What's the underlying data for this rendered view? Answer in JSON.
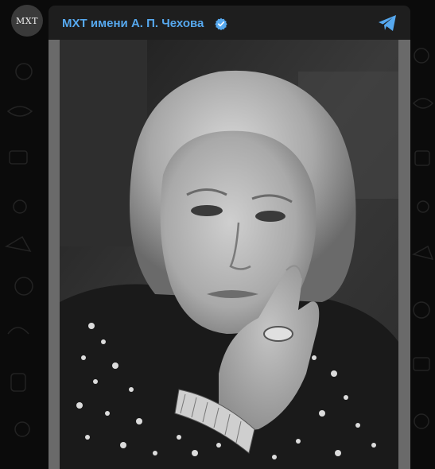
{
  "channel": {
    "avatar_text": "МХТ",
    "name": "МХТ имени А. П. Чехова",
    "verified": true,
    "verified_icon": "verified-badge-icon",
    "share_icon": "telegram-share-icon",
    "accent_color": "#56a8ee"
  },
  "post": {
    "image_icon": "portrait-photo"
  }
}
